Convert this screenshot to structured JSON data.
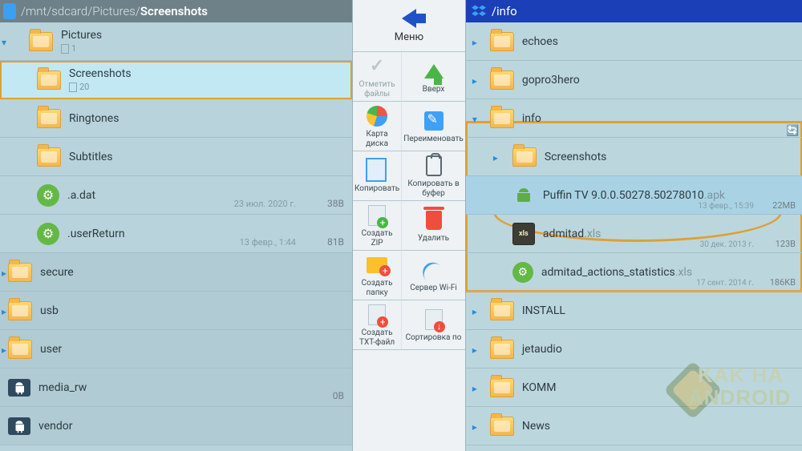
{
  "left": {
    "path_prefix": "/mnt/sdcard/Pictures/",
    "path_current": "Screenshots",
    "rows": [
      {
        "type": "folder",
        "name": "Pictures",
        "subcount": "1",
        "indent": 0,
        "expanded": true
      },
      {
        "type": "folder",
        "name": "Screenshots",
        "subcount": "20",
        "indent": 1,
        "highlighted": true
      },
      {
        "type": "folder",
        "name": "Ringtones",
        "indent": 1
      },
      {
        "type": "folder",
        "name": "Subtitles",
        "indent": 1
      },
      {
        "type": "gear",
        "name": ".a.dat",
        "date": "23 июл. 2020 г.",
        "size": "38B",
        "indent": 1
      },
      {
        "type": "gear",
        "name": ".userReturn",
        "date": "13 февр., 1:44",
        "size": "81B",
        "indent": 1
      },
      {
        "type": "folder",
        "name": "secure",
        "indent": "root",
        "expandable": true
      },
      {
        "type": "folder",
        "name": "usb",
        "indent": "root",
        "expandable": true
      },
      {
        "type": "folder",
        "name": "user",
        "indent": "root",
        "expandable": true
      },
      {
        "type": "android",
        "name": "media_rw",
        "size": "0B",
        "indent": "root"
      },
      {
        "type": "android",
        "name": "vendor",
        "indent": "root"
      }
    ]
  },
  "mid": {
    "menu_label": "Меню",
    "tools": [
      {
        "icon": "check",
        "label": "Отметить файлы",
        "muted": true
      },
      {
        "icon": "up",
        "label": "Вверх"
      },
      {
        "icon": "pie",
        "label": "Карта диска"
      },
      {
        "icon": "pencil",
        "label": "Переименовать"
      },
      {
        "icon": "copy",
        "label": "Копировать"
      },
      {
        "icon": "clip",
        "label": "Копировать в буфер"
      },
      {
        "icon": "zip",
        "label": "Создать ZIP"
      },
      {
        "icon": "trash",
        "label": "Удалить"
      },
      {
        "icon": "fold",
        "label": "Создать папку"
      },
      {
        "icon": "wifi",
        "label": "Сервер Wi-Fi"
      },
      {
        "icon": "txt",
        "label": "Создать TXT-файл"
      },
      {
        "icon": "sort",
        "label": "Сортировка по"
      }
    ]
  },
  "right": {
    "header_path": "/info",
    "rows": [
      {
        "type": "folder",
        "name": "echoes",
        "level": 0,
        "expandable": true
      },
      {
        "type": "folder",
        "name": "gopro3hero",
        "level": 0,
        "expandable": true
      },
      {
        "type": "folder",
        "name": "info",
        "level": 0,
        "expanded": true
      },
      {
        "type": "folder",
        "name": "Screenshots",
        "level": 1,
        "expandable": true
      },
      {
        "type": "apk",
        "name": "Puffin TV 9.0.0.50278.50278010",
        "ext": ".apk",
        "date": "13 февр., 15:39",
        "size": "22MB",
        "level": 1,
        "selected": true
      },
      {
        "type": "xls",
        "name": "admitad",
        "ext": ".xls",
        "date": "30 дек. 2013 г.",
        "size": "123B",
        "level": 1
      },
      {
        "type": "gear",
        "name": "admitad_actions_statistics",
        "ext": ".xls",
        "date": "17 сент. 2014 г.",
        "size": "186KB",
        "level": 1
      },
      {
        "type": "folder",
        "name": "INSTALL",
        "level": 0,
        "expandable": true
      },
      {
        "type": "folder",
        "name": "jetaudio",
        "level": 0,
        "expandable": true
      },
      {
        "type": "folder",
        "name": "KOMM",
        "level": 0,
        "expandable": true
      },
      {
        "type": "folder",
        "name": "News",
        "level": 0,
        "expandable": true
      }
    ]
  },
  "watermark": {
    "line1": "KAK HA",
    "line2": "ANDROID"
  }
}
